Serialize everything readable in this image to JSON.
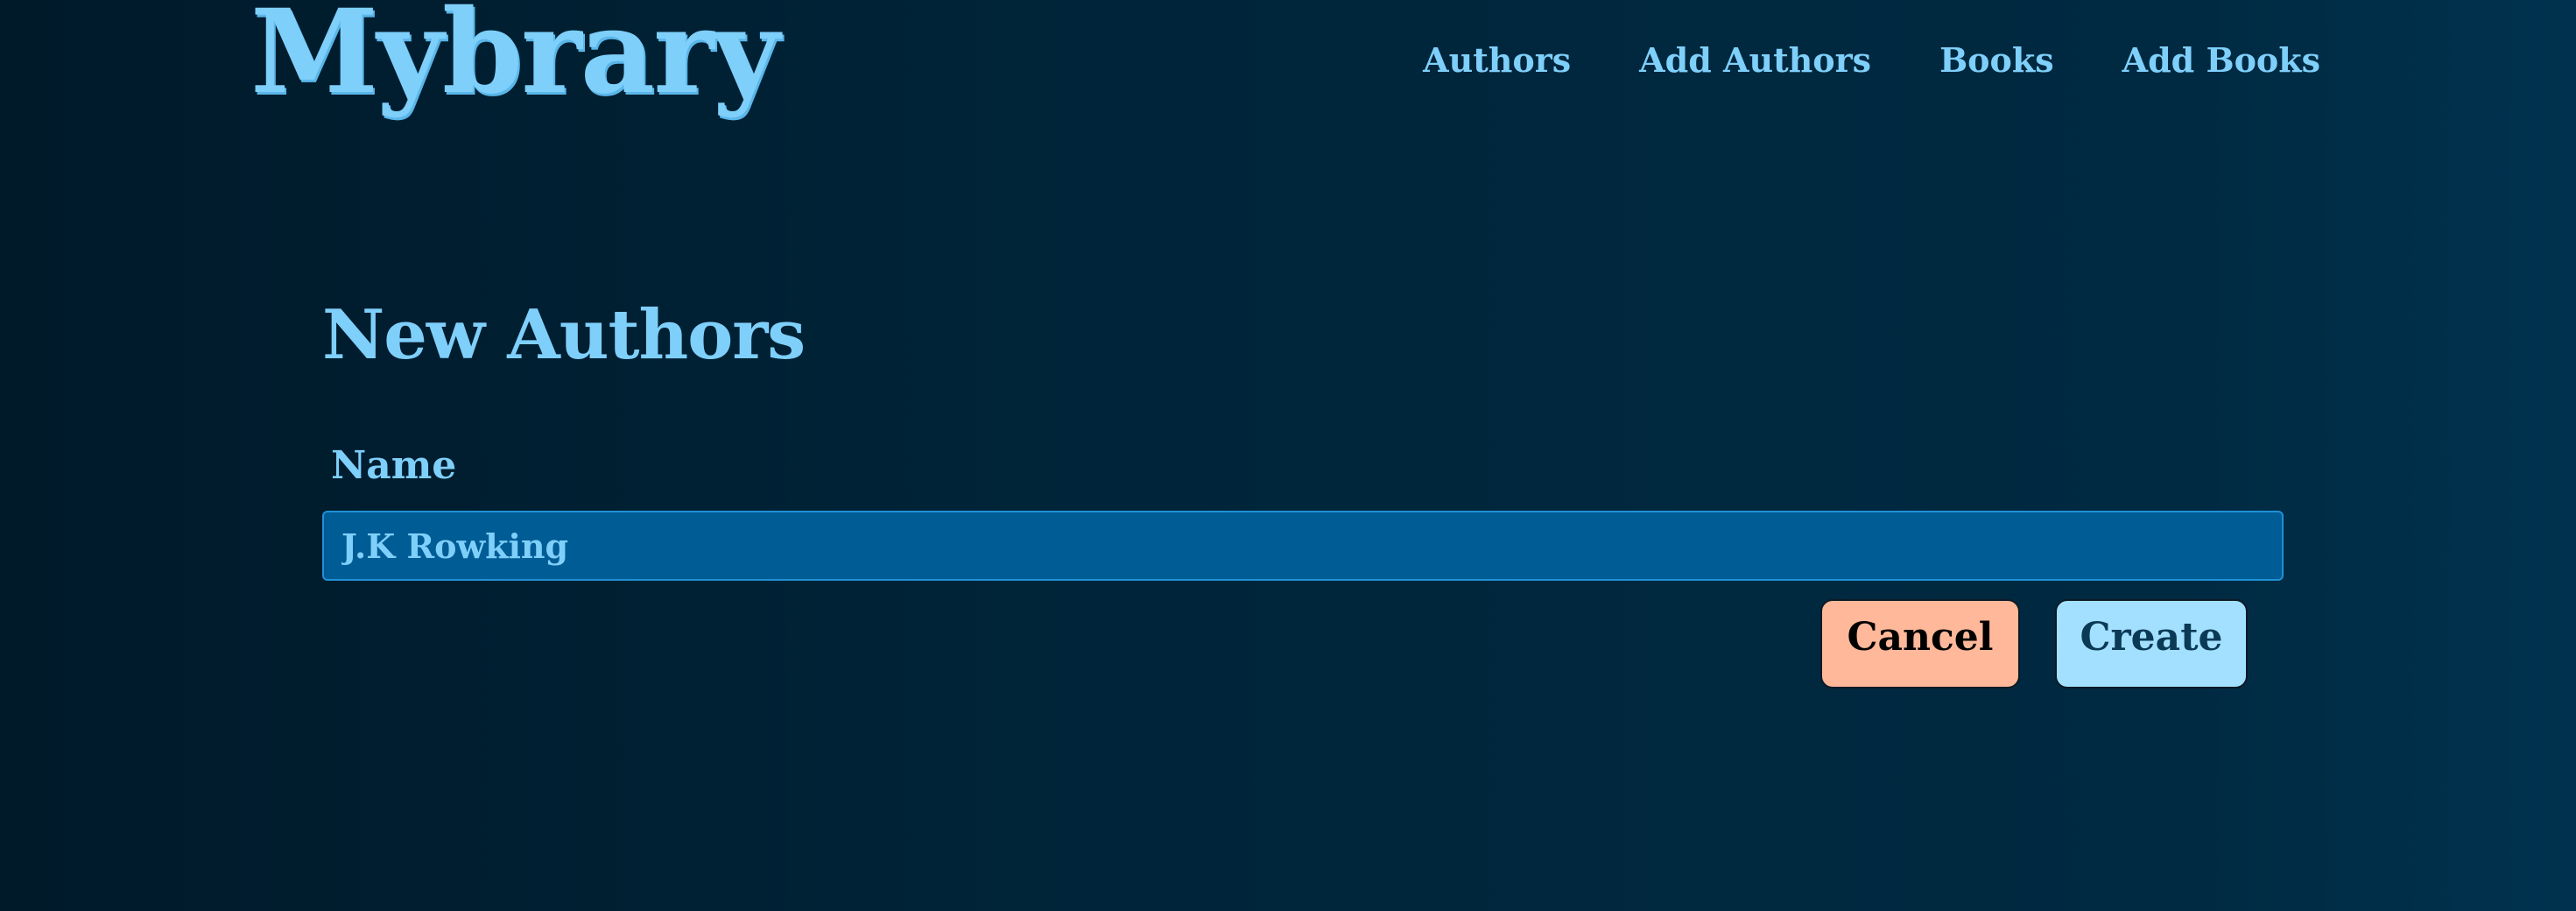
{
  "app": {
    "logo_text": "Mybrary"
  },
  "nav": {
    "items": [
      {
        "label": "Authors"
      },
      {
        "label": "Add Authors"
      },
      {
        "label": "Books"
      },
      {
        "label": "Add Books"
      }
    ]
  },
  "main": {
    "title": "New Authors",
    "form": {
      "name_label": "Name",
      "name_value": "J.K Rowking",
      "cancel_label": "Cancel",
      "create_label": "Create"
    }
  },
  "colors": {
    "accent": "#7ecffa",
    "input_background": "#005c94",
    "cancel_button": "#ffb899",
    "create_button": "#a3e0ff"
  }
}
